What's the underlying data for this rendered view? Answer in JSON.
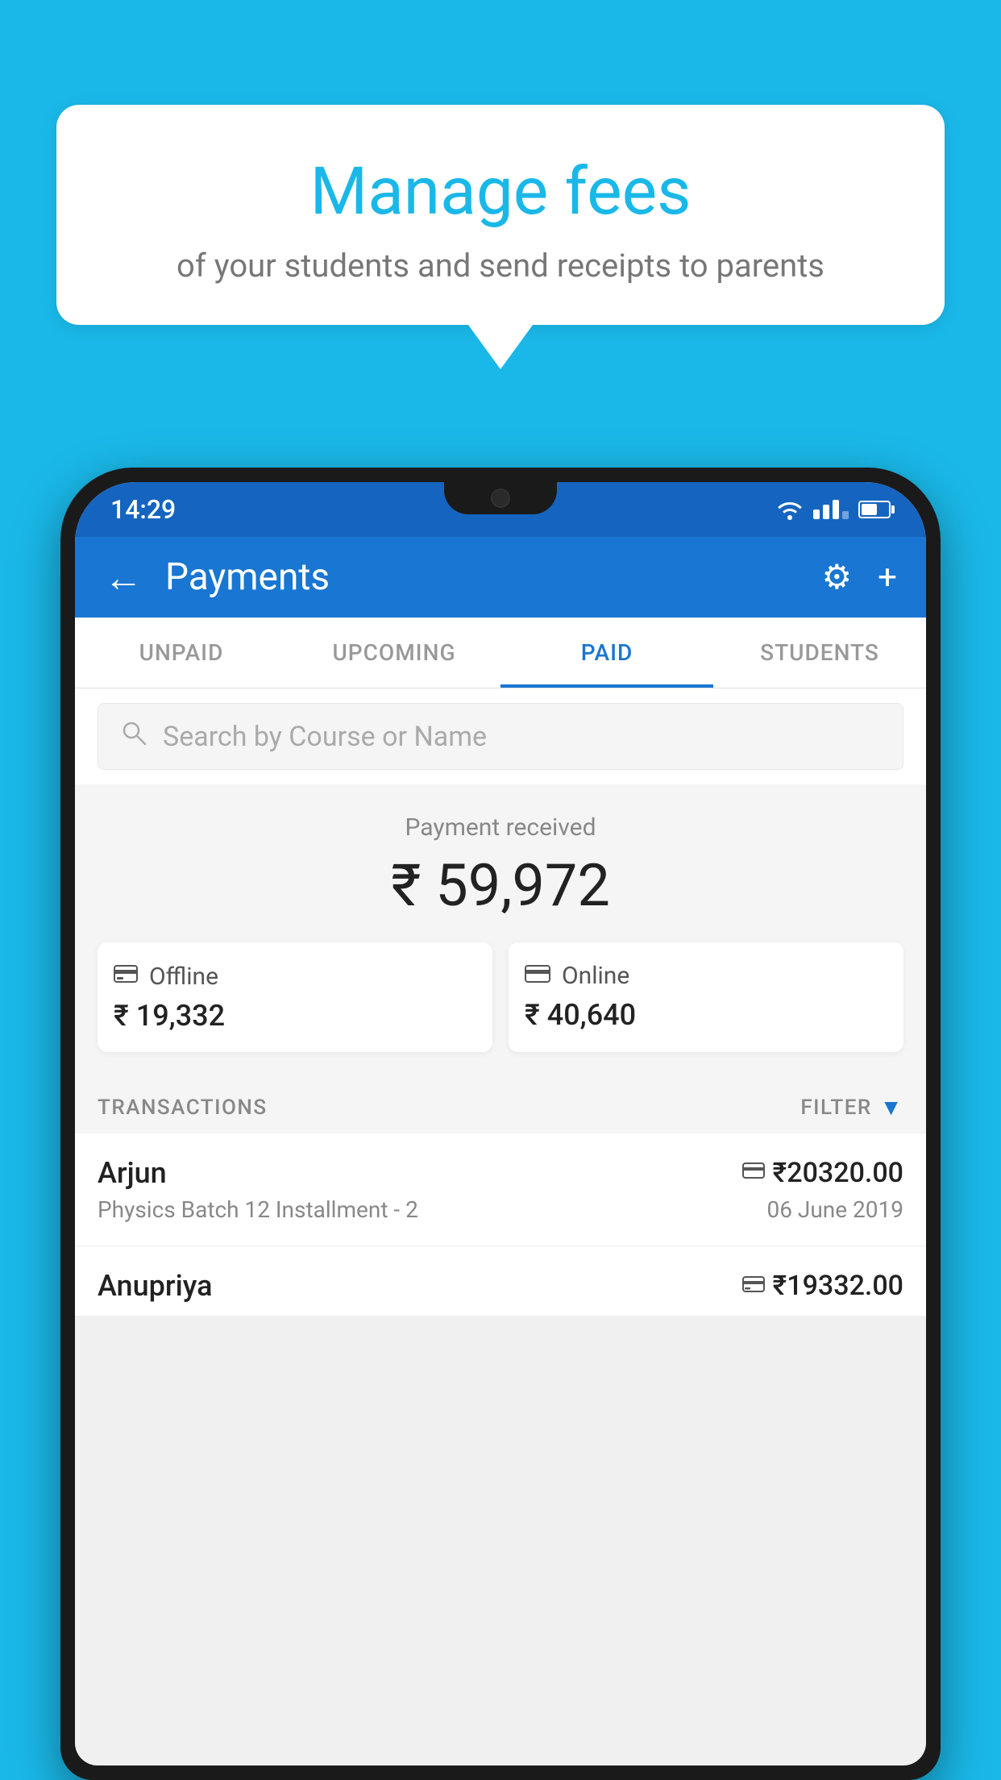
{
  "background_color": "#1ab8e8",
  "speech_bubble": {
    "title": "Manage fees",
    "subtitle": "of your students and send receipts to parents"
  },
  "status_bar": {
    "time": "14:29",
    "wifi_icon": "wifi",
    "signal_icon": "signal",
    "battery_icon": "battery"
  },
  "header": {
    "title": "Payments",
    "back_label": "←",
    "settings_icon": "⚙",
    "add_icon": "+"
  },
  "tabs": [
    {
      "label": "UNPAID",
      "active": false
    },
    {
      "label": "UPCOMING",
      "active": false
    },
    {
      "label": "PAID",
      "active": true
    },
    {
      "label": "STUDENTS",
      "active": false
    }
  ],
  "search": {
    "placeholder": "Search by Course or Name"
  },
  "payment_summary": {
    "label": "Payment received",
    "total": "₹ 59,972",
    "offline": {
      "label": "Offline",
      "amount": "₹ 19,332"
    },
    "online": {
      "label": "Online",
      "amount": "₹ 40,640"
    }
  },
  "transactions_header": {
    "label": "TRANSACTIONS",
    "filter_label": "FILTER"
  },
  "transactions": [
    {
      "name": "Arjun",
      "course": "Physics Batch 12 Installment - 2",
      "amount": "₹20320.00",
      "date": "06 June 2019",
      "payment_type": "card"
    },
    {
      "name": "Anupriya",
      "amount": "₹19332.00",
      "payment_type": "offline"
    }
  ]
}
